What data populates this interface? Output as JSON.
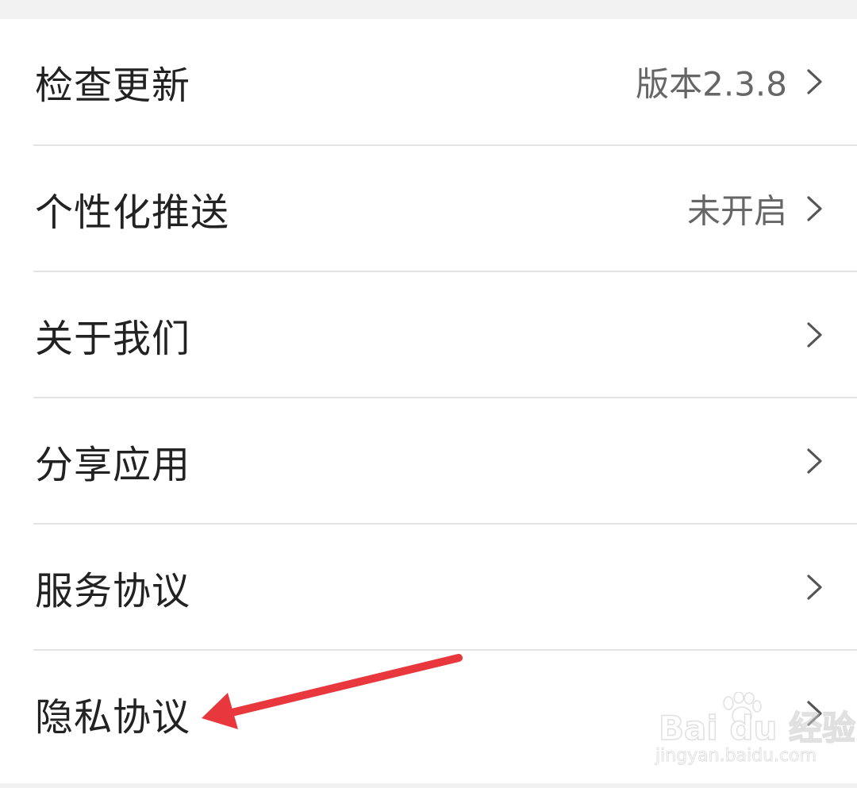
{
  "settings": {
    "items": [
      {
        "label": "检查更新",
        "value": "版本2.3.8"
      },
      {
        "label": "个性化推送",
        "value": "未开启"
      },
      {
        "label": "关于我们",
        "value": ""
      },
      {
        "label": "分享应用",
        "value": ""
      },
      {
        "label": "服务协议",
        "value": ""
      },
      {
        "label": "隐私协议",
        "value": ""
      }
    ]
  },
  "annotation": {
    "arrow_color": "#e8383d",
    "points_to": "隐私协议"
  },
  "watermark": {
    "brand": "Bai du 经验",
    "url": "jingyan.baidu.com"
  },
  "colors": {
    "page_background": "#f2f2f2",
    "row_background": "#ffffff",
    "label_text": "#222222",
    "value_text": "#666666",
    "divider": "#e3e3e3"
  }
}
